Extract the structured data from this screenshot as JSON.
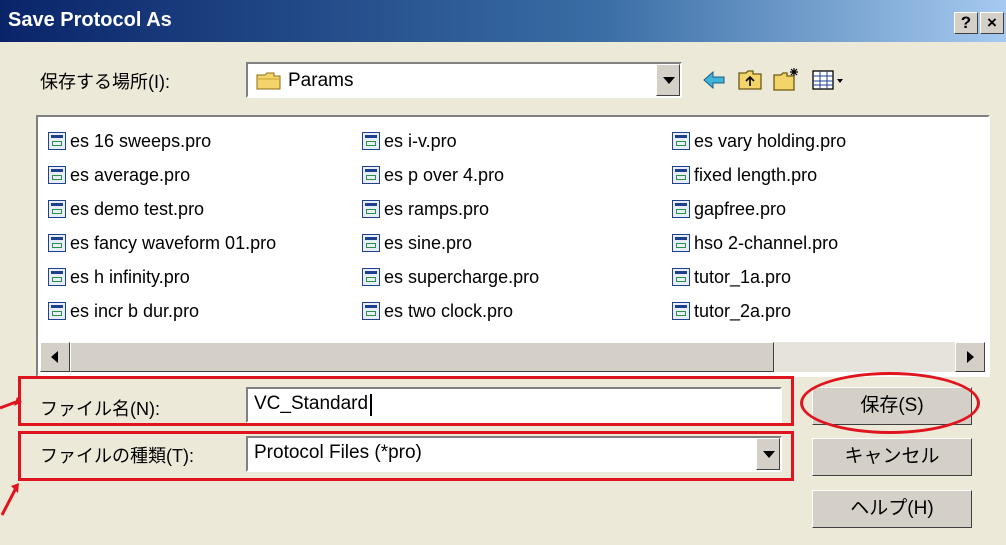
{
  "window": {
    "title": "Save Protocol As",
    "help_label": "?",
    "close_label": "×"
  },
  "location": {
    "label": "保存する場所(I):",
    "value": "Params"
  },
  "toolbar": {
    "icons": [
      "back-arrow-icon",
      "up-folder-icon",
      "new-folder-icon",
      "view-menu-icon"
    ]
  },
  "files": [
    [
      "es 16 sweeps.pro",
      "es average.pro",
      "es demo test.pro",
      "es fancy waveform 01.pro",
      "es h infinity.pro",
      "es incr b dur.pro"
    ],
    [
      "es i-v.pro",
      "es p over 4.pro",
      "es ramps.pro",
      "es sine.pro",
      "es supercharge.pro",
      "es two clock.pro"
    ],
    [
      "es vary holding.pro",
      "fixed length.pro",
      "gapfree.pro",
      "hso 2-channel.pro",
      "tutor_1a.pro",
      "tutor_2a.pro"
    ]
  ],
  "filename": {
    "label": "ファイル名(N):",
    "value": "VC_Standard"
  },
  "filetype": {
    "label": "ファイルの種類(T):",
    "value": "Protocol Files (*pro)"
  },
  "buttons": {
    "save": "保存(S)",
    "cancel": "キャンセル",
    "help": "ヘルプ(H)"
  },
  "colors": {
    "annotation": "#e0141e",
    "titlebar": "#0a246a",
    "dialog": "#ece9d8"
  }
}
